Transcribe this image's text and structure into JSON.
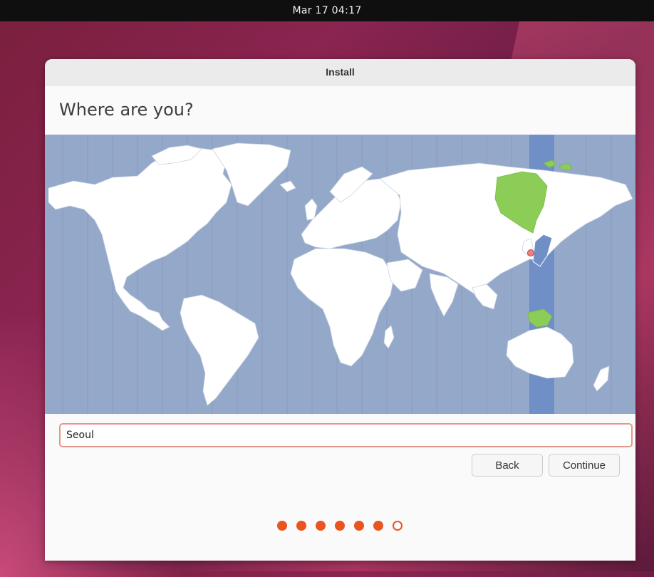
{
  "topbar": {
    "datetime": "Mar 17  04:17"
  },
  "window": {
    "title": "Install"
  },
  "page": {
    "heading": "Where are you?"
  },
  "location": {
    "value": "Seoul"
  },
  "buttons": {
    "back": "Back",
    "continue": "Continue"
  },
  "progress": {
    "total_steps": 7,
    "completed_steps": 6
  },
  "colors": {
    "accent": "#e9541f",
    "ocean": "#94a8c9",
    "land": "#ffffff",
    "selected_timezone_band": "#6f8fc6",
    "selected_region": "#8ccd57",
    "marker": "#f08080"
  },
  "icons": {
    "location_marker": "map-pin-icon"
  }
}
